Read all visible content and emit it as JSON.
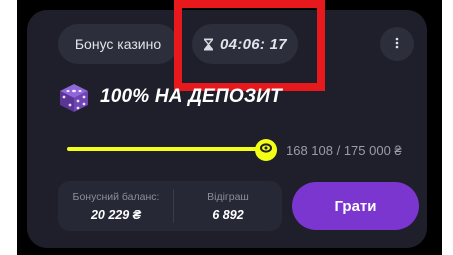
{
  "header": {
    "bonus_label": "Бонус казино",
    "timer": "04:06: 17",
    "menu_icon": "more-vertical-icon"
  },
  "promo": {
    "icon": "dice-icon",
    "title": "100% НА ДЕПОЗИТ"
  },
  "progress": {
    "text": "168 108 / 175 000 ₴",
    "fraction": 0.96,
    "color": "#f3ff14"
  },
  "stats": {
    "bonus_balance_label": "Бонусний баланс:",
    "bonus_balance_value": "20 229 ₴",
    "wager_label": "Відіграш",
    "wager_value": "6 892"
  },
  "actions": {
    "play_label": "Грати",
    "play_color": "#7a36cf"
  },
  "colors": {
    "card_bg": "#1e1f2a",
    "highlight_box": "#e8191c",
    "accent": "#f3ff14"
  }
}
